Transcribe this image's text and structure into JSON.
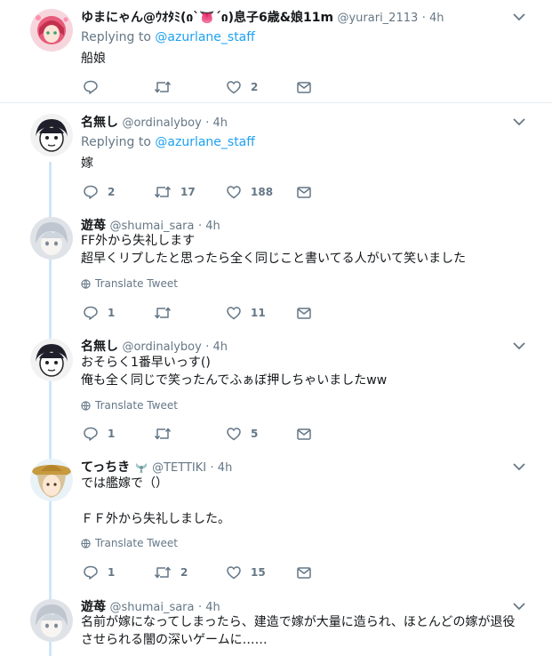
{
  "colors": {
    "link": "#1da1f2",
    "secondary": "#657786",
    "thread_line": "#cfe7f7",
    "divider": "#e6ecf0"
  },
  "tweets": [
    {
      "name": "ゆまにゃん@ｳｵﾀﾐ(ი`👅´ი)息子6歳&娘11m",
      "handle": "@yurari_2113",
      "time": "· 4h",
      "replying_prefix": "Replying to",
      "replying_to": "@azurlane_staff",
      "lines": [
        "船娘"
      ],
      "replies": "",
      "retweets": "",
      "likes": "2"
    },
    {
      "name": "名無し",
      "handle": "@ordinalyboy",
      "time": "· 4h",
      "replying_prefix": "Replying to",
      "replying_to": "@azurlane_staff",
      "lines": [
        "嫁"
      ],
      "replies": "2",
      "retweets": "17",
      "likes": "188"
    },
    {
      "name": "遊苺",
      "handle": "@shumai_sara",
      "time": "· 4h",
      "lines": [
        "FF外から失礼します",
        "超早くリプしたと思ったら全く同じこと書いてる人がいて笑いました"
      ],
      "translate": "Translate Tweet",
      "replies": "1",
      "retweets": "",
      "likes": "11"
    },
    {
      "name": "名無し",
      "handle": "@ordinalyboy",
      "time": "· 4h",
      "lines": [
        "おそらく1番早いっす()",
        "俺も全く同じで笑ったんでふぁぼ押しちゃいましたww"
      ],
      "translate": "Translate Tweet",
      "replies": "1",
      "retweets": "",
      "likes": "5"
    },
    {
      "name": "てっちき",
      "handle": "@TETTIKI",
      "time": "· 4h",
      "lines": [
        "では艦嫁で（）",
        "",
        "ＦＦ外から失礼しました。"
      ],
      "translate": "Translate Tweet",
      "replies": "1",
      "retweets": "2",
      "likes": "15"
    },
    {
      "name": "遊苺",
      "handle": "@shumai_sara",
      "time": "· 4h",
      "lines": [
        "名前が嫁になってしまったら、建造で嫁が大量に造られ、ほとんどの嫁が退役",
        "させられる闇の深いゲームに……"
      ]
    }
  ]
}
